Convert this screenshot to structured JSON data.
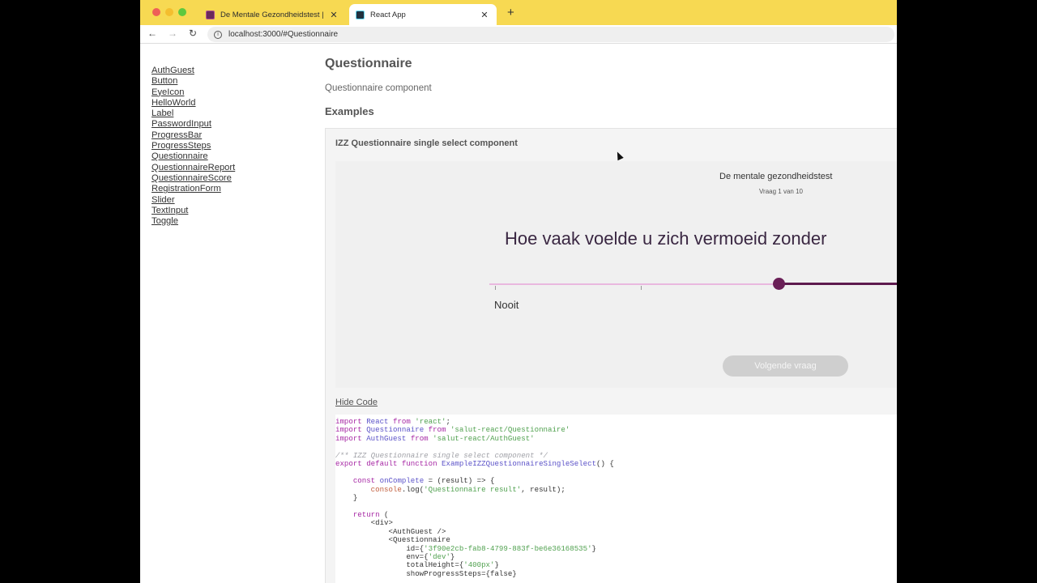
{
  "browser": {
    "tabs": [
      {
        "title": "De Mentale Gezondheidstest |"
      },
      {
        "title": "React App"
      }
    ],
    "url": "localhost:3000/#Questionnaire"
  },
  "sidebar": {
    "items": [
      "AuthGuest",
      "Button",
      "EyeIcon",
      "HelloWorld",
      "Label",
      "PasswordInput",
      "ProgressBar",
      "ProgressSteps",
      "Questionnaire",
      "QuestionnaireReport",
      "QuestionnaireScore",
      "RegistrationForm",
      "Slider",
      "TextInput",
      "Toggle"
    ]
  },
  "content": {
    "title": "Questionnaire",
    "description": "Questionnaire component",
    "examples_heading": "Examples",
    "example": {
      "title": "IZZ Questionnaire single select component",
      "heading": "De mentale gezondheidstest",
      "progress": "Vraag 1 van 10",
      "question": "Hoe vaak voelde u zich vermoeid zonder",
      "slider_value": 0.7,
      "scale_label": "Nooit",
      "next_label": "Volgende vraag",
      "hide_code_label": "Hide Code"
    },
    "code_lines": [
      "import React from 'react';",
      "import Questionnaire from 'salut-react/Questionnaire'",
      "import AuthGuest from 'salut-react/AuthGuest'",
      "",
      "/** IZZ Questionnaire single select component */",
      "export default function ExampleIZZQuestionnaireSingleSelect() {",
      "",
      "    const onComplete = (result) => {",
      "        console.log('Questionnaire result', result);",
      "    }",
      "",
      "    return (",
      "        <div>",
      "            <AuthGuest />",
      "            <Questionnaire",
      "                id={'3f90e2cb-fab8-4799-883f-be6e36168535'}",
      "                env={'dev'}",
      "                totalHeight={'400px'}",
      "                showProgressSteps={false}"
    ]
  },
  "colors": {
    "accent": "#6a1f57",
    "track_light": "#e9b8df",
    "tabbar": "#f7d952"
  }
}
